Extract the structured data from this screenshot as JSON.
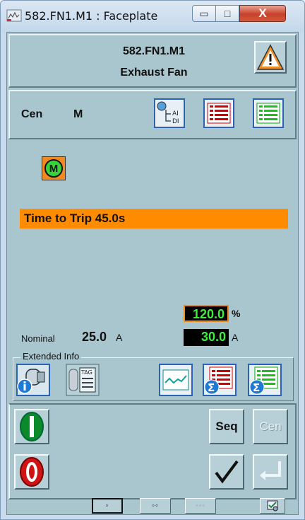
{
  "window": {
    "title": "582.FN1.M1 : Faceplate",
    "minimize_glyph": "▭",
    "maximize_glyph": "□",
    "close_glyph": "X"
  },
  "header": {
    "tag": "582.FN1.M1",
    "description": "Exhaust Fan",
    "warning_icon": "warning-triangle-icon"
  },
  "mode": {
    "control": "Cen",
    "state": "M",
    "buttons": [
      {
        "name": "ai-di-icon",
        "label_top": "AI",
        "label_bottom": "DI"
      },
      {
        "name": "red-list-icon"
      },
      {
        "name": "green-list-icon"
      }
    ]
  },
  "motor": {
    "symbol": "M",
    "color": "#35d43d",
    "frame_color": "#f08a20"
  },
  "alarm": {
    "text": "Time to Trip 45.0s",
    "color": "#ff8c00"
  },
  "measurements": {
    "load_value": "120.0",
    "load_unit": "%",
    "current_value": "30.0",
    "current_unit": "A",
    "nominal_label": "Nominal",
    "nominal_value": "25.0",
    "nominal_unit": "A"
  },
  "extended_info": {
    "legend": "Extended Info",
    "tag_label": "TAG",
    "buttons": [
      "info-icon",
      "tag-icon",
      "trend-icon",
      "sum-red-list-icon",
      "sum-green-list-icon"
    ]
  },
  "commands": {
    "start_label": "I",
    "stop_label": "0",
    "seq_label": "Seq",
    "cen_label": "Cen",
    "ack_icon": "checkmark-icon",
    "enter_icon": "enter-arrow-icon"
  },
  "footer": {
    "view_1": "◦",
    "view_2": "◦◦",
    "view_3": "◦◦◦"
  }
}
